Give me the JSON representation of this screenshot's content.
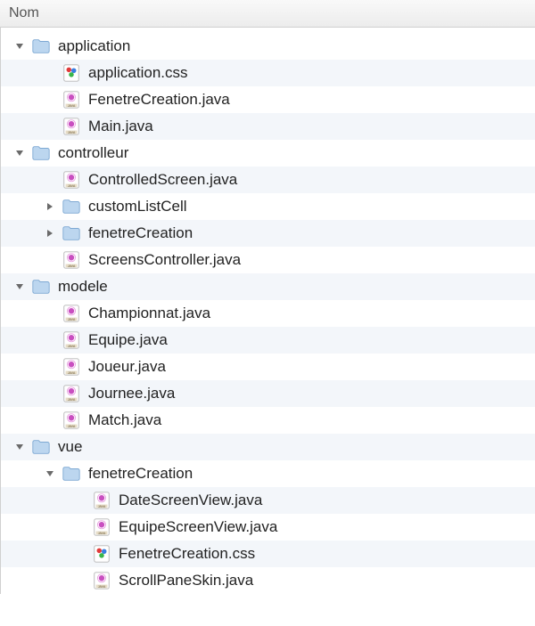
{
  "header": {
    "title": "Nom"
  },
  "icons": {
    "folder": "folder-icon",
    "java": "java-file-icon",
    "css": "css-file-icon"
  },
  "tree": [
    {
      "depth": 0,
      "disclosure": "open",
      "icon": "folder",
      "label": "application"
    },
    {
      "depth": 1,
      "disclosure": "none",
      "icon": "css",
      "label": "application.css"
    },
    {
      "depth": 1,
      "disclosure": "none",
      "icon": "java",
      "label": "FenetreCreation.java"
    },
    {
      "depth": 1,
      "disclosure": "none",
      "icon": "java",
      "label": "Main.java"
    },
    {
      "depth": 0,
      "disclosure": "open",
      "icon": "folder",
      "label": "controlleur"
    },
    {
      "depth": 1,
      "disclosure": "none",
      "icon": "java",
      "label": "ControlledScreen.java"
    },
    {
      "depth": 1,
      "disclosure": "closed",
      "icon": "folder",
      "label": "customListCell"
    },
    {
      "depth": 1,
      "disclosure": "closed",
      "icon": "folder",
      "label": "fenetreCreation"
    },
    {
      "depth": 1,
      "disclosure": "none",
      "icon": "java",
      "label": "ScreensController.java"
    },
    {
      "depth": 0,
      "disclosure": "open",
      "icon": "folder",
      "label": "modele"
    },
    {
      "depth": 1,
      "disclosure": "none",
      "icon": "java",
      "label": "Championnat.java"
    },
    {
      "depth": 1,
      "disclosure": "none",
      "icon": "java",
      "label": "Equipe.java"
    },
    {
      "depth": 1,
      "disclosure": "none",
      "icon": "java",
      "label": "Joueur.java"
    },
    {
      "depth": 1,
      "disclosure": "none",
      "icon": "java",
      "label": "Journee.java"
    },
    {
      "depth": 1,
      "disclosure": "none",
      "icon": "java",
      "label": "Match.java"
    },
    {
      "depth": 0,
      "disclosure": "open",
      "icon": "folder",
      "label": "vue"
    },
    {
      "depth": 1,
      "disclosure": "open",
      "icon": "folder",
      "label": "fenetreCreation"
    },
    {
      "depth": 2,
      "disclosure": "none",
      "icon": "java",
      "label": "DateScreenView.java"
    },
    {
      "depth": 2,
      "disclosure": "none",
      "icon": "java",
      "label": "EquipeScreenView.java"
    },
    {
      "depth": 2,
      "disclosure": "none",
      "icon": "css",
      "label": "FenetreCreation.css"
    },
    {
      "depth": 2,
      "disclosure": "none",
      "icon": "java",
      "label": "ScrollPaneSkin.java"
    }
  ]
}
